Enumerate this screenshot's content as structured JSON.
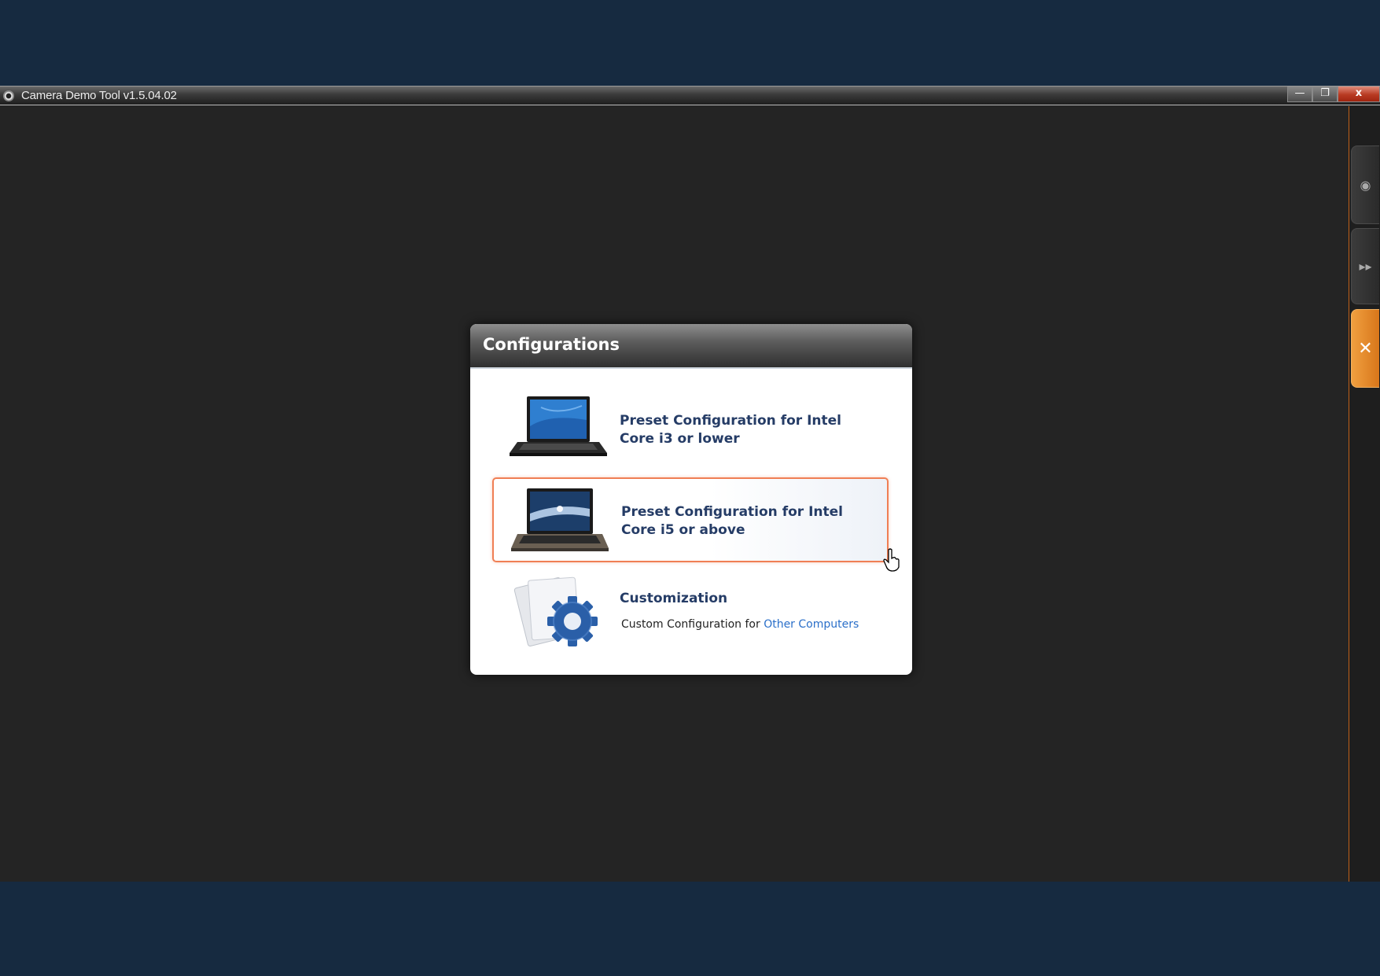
{
  "window": {
    "title": "Camera Demo Tool v1.5.04.02",
    "buttons": {
      "minimize": "—",
      "restore": "❐",
      "close": "x"
    }
  },
  "side_tabs": [
    {
      "icon": "eye-icon",
      "glyph": "◉"
    },
    {
      "icon": "fast-forward-icon",
      "glyph": "▸▸"
    },
    {
      "icon": "tools-icon",
      "glyph": "✕"
    }
  ],
  "dialog": {
    "title": "Configurations",
    "options": [
      {
        "label": "Preset Configuration for Intel Core i3 or lower",
        "icon": "laptop-icon"
      },
      {
        "label": "Preset Configuration for Intel Core i5 or above",
        "icon": "laptop-icon",
        "selected": true
      },
      {
        "label": "Customization",
        "icon": "gear-icon",
        "sub_prefix": "Custom Configuration for ",
        "sub_link": "Other Computers"
      }
    ]
  },
  "colors": {
    "accent": "#f07f55",
    "link": "#2a6fc9",
    "label": "#253c66",
    "background": "#162a40"
  }
}
